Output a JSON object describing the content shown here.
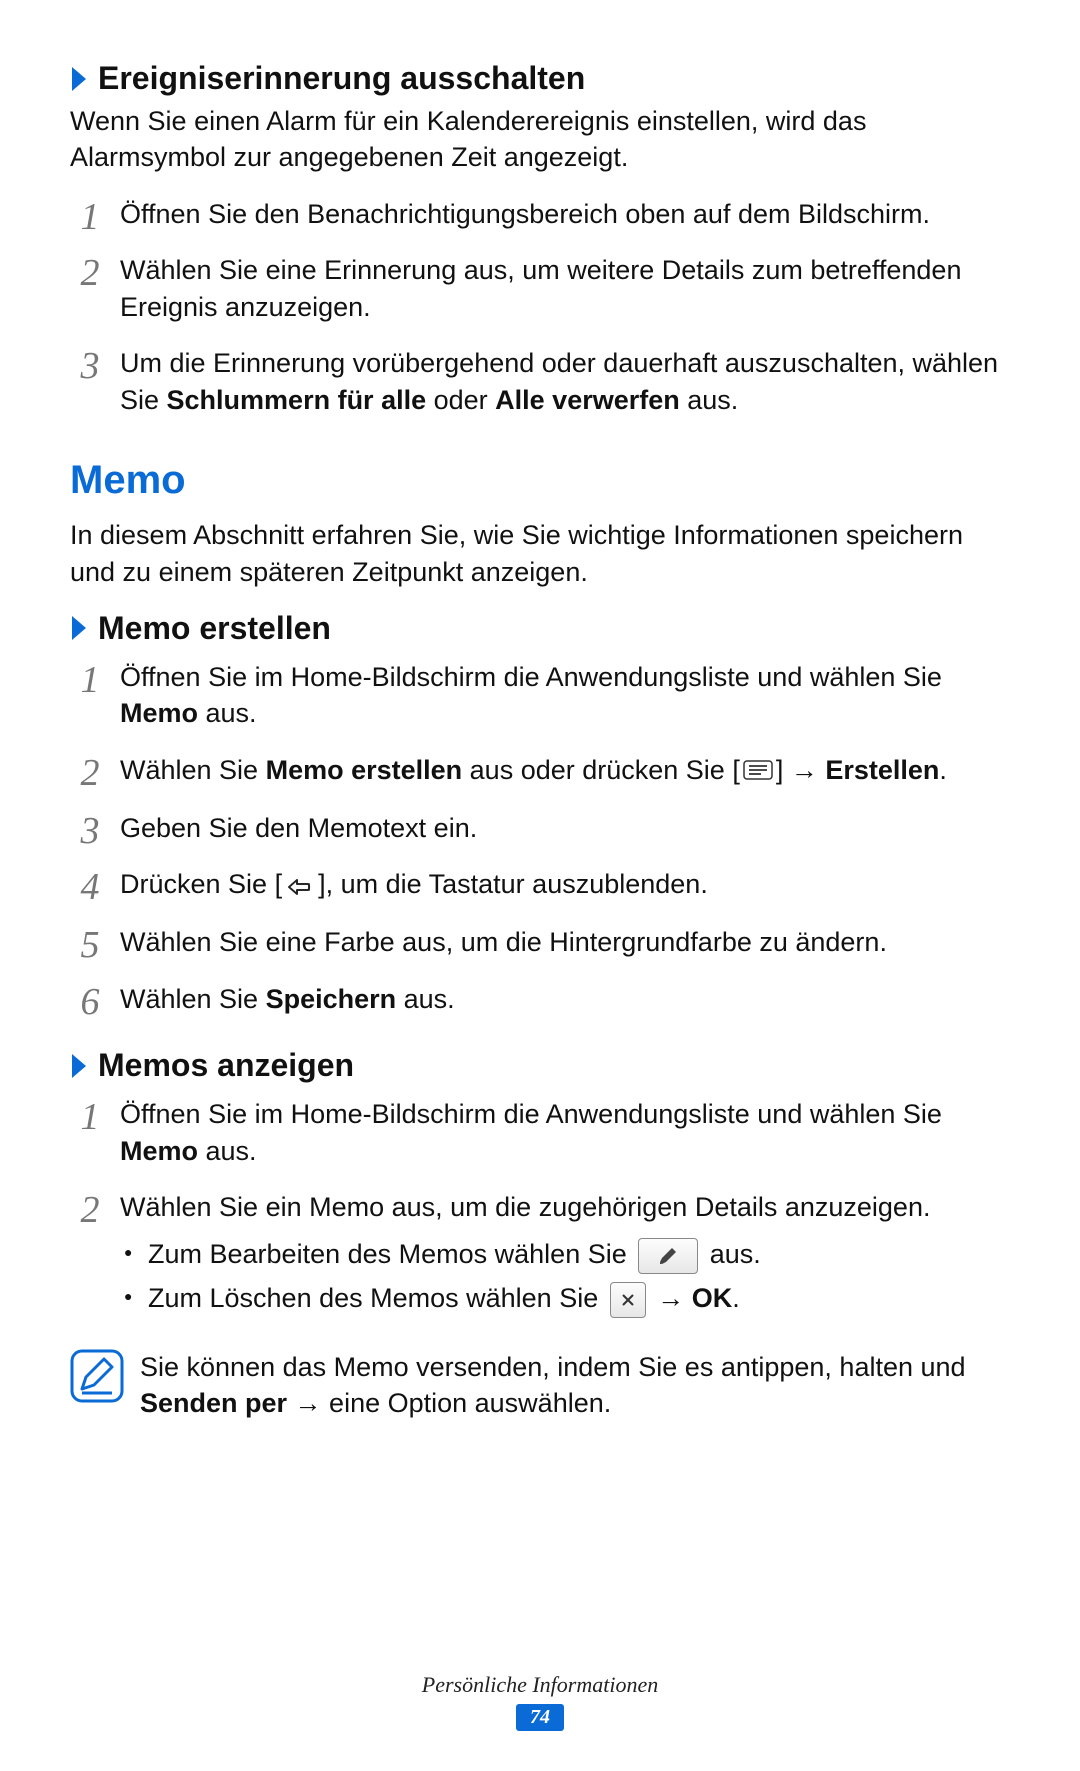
{
  "sec1": {
    "title": "Ereigniserinnerung ausschalten",
    "intro": "Wenn Sie einen Alarm für ein Kalenderereignis einstellen, wird das Alarmsymbol zur angegebenen Zeit angezeigt.",
    "step1": "Öffnen Sie den Benachrichtigungsbereich oben auf dem Bildschirm.",
    "step2": "Wählen Sie eine Erinnerung aus, um weitere Details zum betreffenden Ereignis anzuzeigen.",
    "step3_a": "Um die Erinnerung vorübergehend oder dauerhaft auszuschalten, wählen Sie ",
    "step3_b1": "Schlummern für alle",
    "step3_mid": " oder ",
    "step3_b2": "Alle verwerfen",
    "step3_end": " aus."
  },
  "memo": {
    "title": "Memo",
    "intro": "In diesem Abschnitt erfahren Sie, wie Sie wichtige Informationen speichern und zu einem späteren Zeitpunkt anzeigen."
  },
  "create": {
    "title": "Memo erstellen",
    "s1_a": "Öffnen Sie im Home-Bildschirm die Anwendungsliste und wählen Sie ",
    "s1_b": "Memo",
    "s1_c": " aus.",
    "s2_a": "Wählen Sie ",
    "s2_b": "Memo erstellen",
    "s2_c": " aus oder drücken Sie [",
    "s2_d": "] → ",
    "s2_e": "Erstellen",
    "s2_f": ".",
    "s3": "Geben Sie den Memotext ein.",
    "s4_a": "Drücken Sie [",
    "s4_b": "], um die Tastatur auszublenden.",
    "s5": "Wählen Sie eine Farbe aus, um die Hintergrundfarbe zu ändern.",
    "s6_a": "Wählen Sie ",
    "s6_b": "Speichern",
    "s6_c": " aus."
  },
  "view": {
    "title": "Memos anzeigen",
    "s1_a": "Öffnen Sie im Home-Bildschirm die Anwendungsliste und wählen Sie ",
    "s1_b": "Memo",
    "s1_c": " aus.",
    "s2": "Wählen Sie ein Memo aus, um die zugehörigen Details anzuzeigen.",
    "b1_a": "Zum Bearbeiten des Memos wählen Sie ",
    "b1_b": " aus.",
    "b2_a": "Zum Löschen des Memos wählen Sie ",
    "b2_b": " → ",
    "b2_c": "OK",
    "b2_d": ".",
    "note_a": "Sie können das Memo versenden, indem Sie es antippen, halten und ",
    "note_b": "Senden per",
    "note_c": " → eine Option auswählen."
  },
  "footer": {
    "label": "Persönliche Informationen",
    "page": "74"
  }
}
